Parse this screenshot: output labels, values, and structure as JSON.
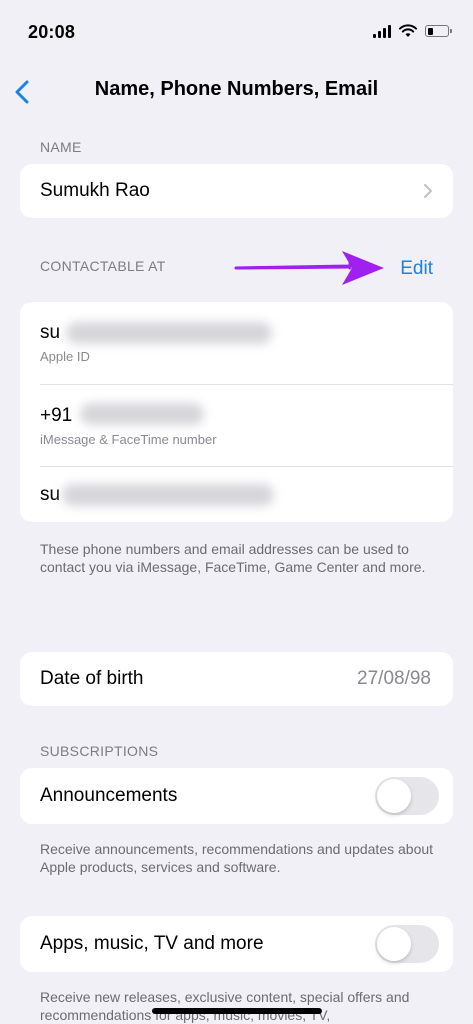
{
  "status": {
    "time": "20:08"
  },
  "nav": {
    "title": "Name, Phone Numbers, Email",
    "back_icon": "chevron-left-icon"
  },
  "name_section": {
    "label": "NAME",
    "value": "Sumukh Rao"
  },
  "contact_section": {
    "label": "CONTACTABLE AT",
    "edit_label": "Edit",
    "items": [
      {
        "value": "su",
        "caption": "Apple ID"
      },
      {
        "value": "+91",
        "caption": "iMessage & FaceTime number"
      },
      {
        "value": "su",
        "caption": ""
      }
    ],
    "note": "These phone numbers and email addresses can be used to contact you via iMessage, FaceTime, Game Center and more."
  },
  "birth": {
    "label": "Date of birth",
    "value": "27/08/98"
  },
  "subscriptions": {
    "label": "SUBSCRIPTIONS",
    "announcements": {
      "label": "Announcements",
      "enabled": false,
      "note": "Receive announcements, recommendations and updates about Apple products, services and software."
    },
    "apps": {
      "label": "Apps, music, TV and more",
      "enabled": false,
      "note": "Receive new releases, exclusive content, special offers and recommendations for apps, music, movies, TV,"
    }
  },
  "colors": {
    "accent": "#1982e4",
    "arrow": "#a020f0",
    "background": "#f1f0f6"
  }
}
